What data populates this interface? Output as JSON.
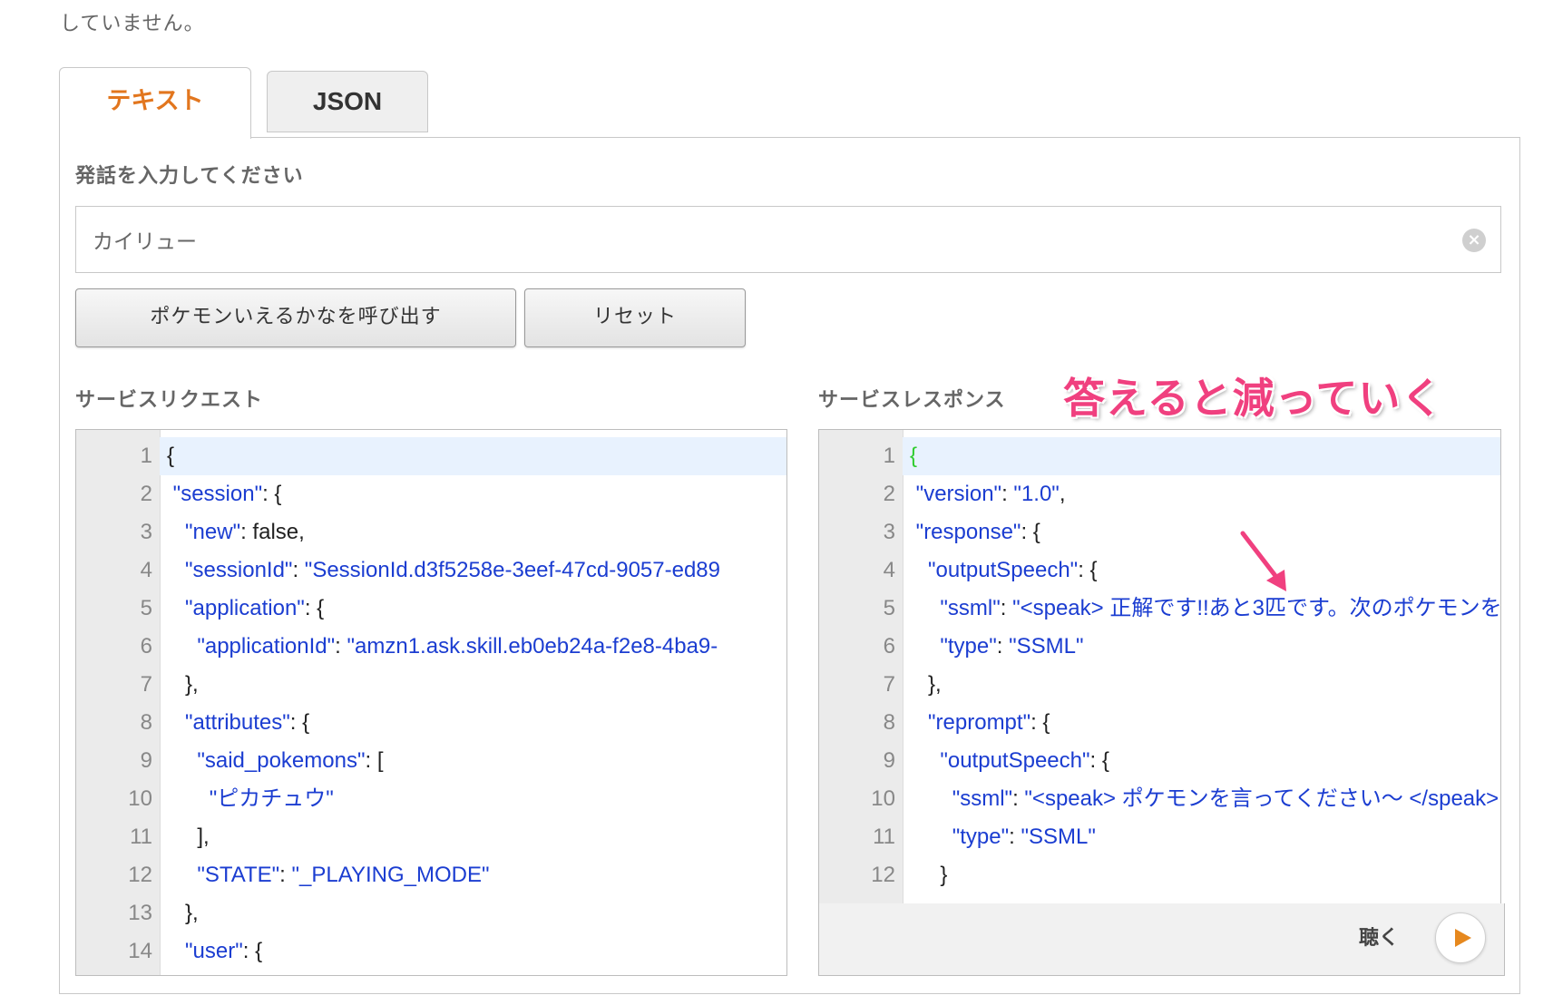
{
  "header": {
    "top_note": "していません。"
  },
  "tabs": [
    {
      "label": "テキスト",
      "active": true
    },
    {
      "label": "JSON",
      "active": false
    }
  ],
  "utterance": {
    "label": "発話を入力してください",
    "value": "カイリュー"
  },
  "buttons": {
    "invoke": "ポケモンいえるかなを呼び出す",
    "reset": "リセット"
  },
  "request": {
    "label": "サービスリクエスト",
    "lines": [
      {
        "n": "1",
        "html": "{"
      },
      {
        "n": "2",
        "html": " <span class=\"k\">\"session\"</span>: {"
      },
      {
        "n": "3",
        "html": "   <span class=\"k\">\"new\"</span>: false,"
      },
      {
        "n": "4",
        "html": "   <span class=\"k\">\"sessionId\"</span>: <span class=\"s\">\"SessionId.d3f5258e-3eef-47cd-9057-ed89</span>"
      },
      {
        "n": "5",
        "html": "   <span class=\"k\">\"application\"</span>: {"
      },
      {
        "n": "6",
        "html": "     <span class=\"k\">\"applicationId\"</span>: <span class=\"s\">\"amzn1.ask.skill.eb0eb24a-f2e8-4ba9-</span>"
      },
      {
        "n": "7",
        "html": "   },"
      },
      {
        "n": "8",
        "html": "   <span class=\"k\">\"attributes\"</span>: {"
      },
      {
        "n": "9",
        "html": "     <span class=\"k\">\"said_pokemons\"</span>: ["
      },
      {
        "n": "10",
        "html": "       <span class=\"s\">\"ピカチュウ\"</span>"
      },
      {
        "n": "11",
        "html": "     ],"
      },
      {
        "n": "12",
        "html": "     <span class=\"k\">\"STATE\"</span>: <span class=\"s\">\"_PLAYING_MODE\"</span>"
      },
      {
        "n": "13",
        "html": "   },"
      },
      {
        "n": "14",
        "html": "   <span class=\"k\">\"user\"</span>: {"
      }
    ]
  },
  "response": {
    "label": "サービスレスポンス",
    "annotation": "答えると減っていく",
    "lines": [
      {
        "n": "1",
        "html": "<span class=\"g\">{</span>"
      },
      {
        "n": "2",
        "html": " <span class=\"k\">\"version\"</span>: <span class=\"s\">\"1.0\"</span>,"
      },
      {
        "n": "3",
        "html": " <span class=\"k\">\"response\"</span>: {"
      },
      {
        "n": "4",
        "html": "   <span class=\"k\">\"outputSpeech\"</span>: {"
      },
      {
        "n": "5",
        "html": "     <span class=\"k\">\"ssml\"</span>: <span class=\"s\">\"&lt;speak&gt; 正解です!!あと3匹です。次のポケモンを</span>"
      },
      {
        "n": "6",
        "html": "     <span class=\"k\">\"type\"</span>: <span class=\"s\">\"SSML\"</span>"
      },
      {
        "n": "7",
        "html": "   },"
      },
      {
        "n": "8",
        "html": "   <span class=\"k\">\"reprompt\"</span>: {"
      },
      {
        "n": "9",
        "html": "     <span class=\"k\">\"outputSpeech\"</span>: {"
      },
      {
        "n": "10",
        "html": "       <span class=\"k\">\"ssml\"</span>: <span class=\"s\">\"&lt;speak&gt; ポケモンを言ってください〜 &lt;/speak&gt;</span>"
      },
      {
        "n": "11",
        "html": "       <span class=\"k\">\"type\"</span>: <span class=\"s\">\"SSML\"</span>"
      },
      {
        "n": "12",
        "html": "     }"
      }
    ],
    "listen_label": "聴く"
  },
  "colors": {
    "active_tab": "#e2761e",
    "annotation": "#f0407f",
    "json_key": "#1b3dd1",
    "play": "#e6881e"
  }
}
